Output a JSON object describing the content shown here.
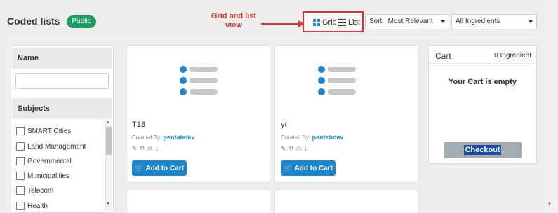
{
  "header": {
    "title": "Coded lists",
    "badge": "Public",
    "annotation": "Grid and list view",
    "view_grid": "Grid",
    "view_list": "List",
    "sort": "Sort : Most Relevant",
    "ingredients_filter": "All Ingredients"
  },
  "sidebar": {
    "name_heading": "Name",
    "name_input_value": "",
    "subjects_heading": "Subjects",
    "subjects": [
      "SMART Cities",
      "Land Management",
      "Governmental",
      "Municipalities",
      "Telecom",
      "Health"
    ]
  },
  "cards": [
    {
      "title": "T13",
      "created_label": "Created By:",
      "author": "pentabdev",
      "button": "Add to Cart"
    },
    {
      "title": "yt",
      "created_label": "Created By:",
      "author": "pentabdev",
      "button": "Add to Cart"
    }
  ],
  "cart": {
    "title": "Cart",
    "count": "0 Ingredient",
    "empty": "Your Cart is empty",
    "checkout": "Checkout"
  },
  "colors": {
    "accent": "#1a86d0",
    "badge": "#1e9e62",
    "annotation": "#e0312a"
  }
}
